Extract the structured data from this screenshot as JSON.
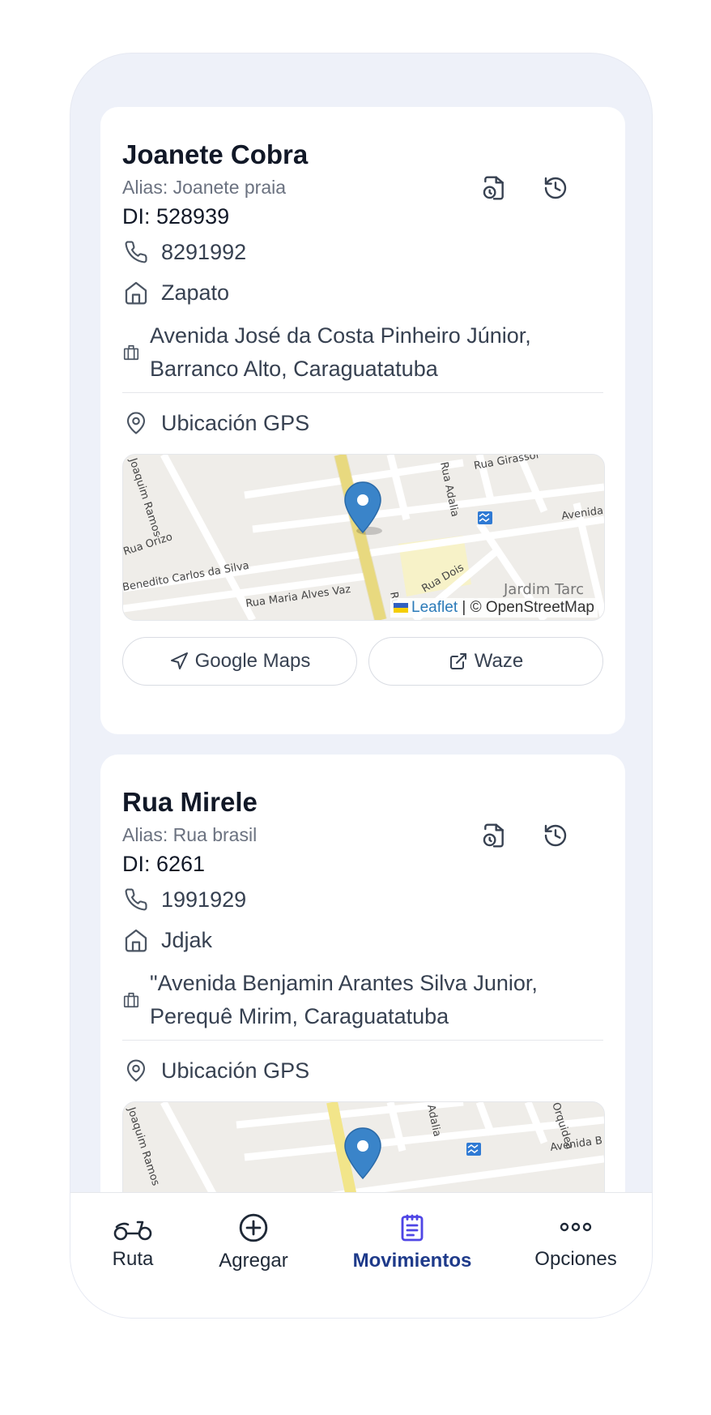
{
  "cards": [
    {
      "name": "Joanete Cobra",
      "alias": "Alias: Joanete praia",
      "di": "DI: 528939",
      "phone": "8291992",
      "type": "Zapato",
      "address": "Avenida José da Costa Pinheiro Júnior, Barranco Alto, Caraguatatuba",
      "gps_label": "Ubicación GPS",
      "map": {
        "streets": [
          "Rua Girassol",
          "Rua Adalia",
          "Avenida",
          "Rua Orizo",
          "Benedito Carlos da Silva",
          "Rua Maria Alves Vaz",
          "Rua Dois",
          "Jardim Tarc",
          "Joaquim Ramos",
          "Rua"
        ],
        "attribution_leaflet": "Leaflet",
        "attribution_rest": " | © OpenStreetMap"
      },
      "btn_google": "Google Maps",
      "btn_waze": "Waze"
    },
    {
      "name": "Rua Mirele",
      "alias": "Alias: Rua brasil",
      "di": "DI: 6261",
      "phone": "1991929",
      "type": "Jdjak",
      "address": "\"Avenida Benjamin Arantes Silva Junior, Perequê Mirim, Caraguatatuba",
      "gps_label": "Ubicación GPS",
      "map": {
        "streets": [
          "Adalia",
          "Orquidea",
          "Avenida B",
          "Joaquim Ramos"
        ]
      }
    }
  ],
  "nav": [
    {
      "label": "Ruta",
      "icon": "scooter-icon"
    },
    {
      "label": "Agregar",
      "icon": "plus-circle-icon"
    },
    {
      "label": "Movimientos",
      "icon": "clipboard-list-icon",
      "active": true
    },
    {
      "label": "Opciones",
      "icon": "more-dots-icon"
    }
  ],
  "colors": {
    "accent": "#1e3a8a",
    "nav_active_icon": "#4f46e5",
    "background": "#eef1f9",
    "marker": "#3a84c9"
  }
}
